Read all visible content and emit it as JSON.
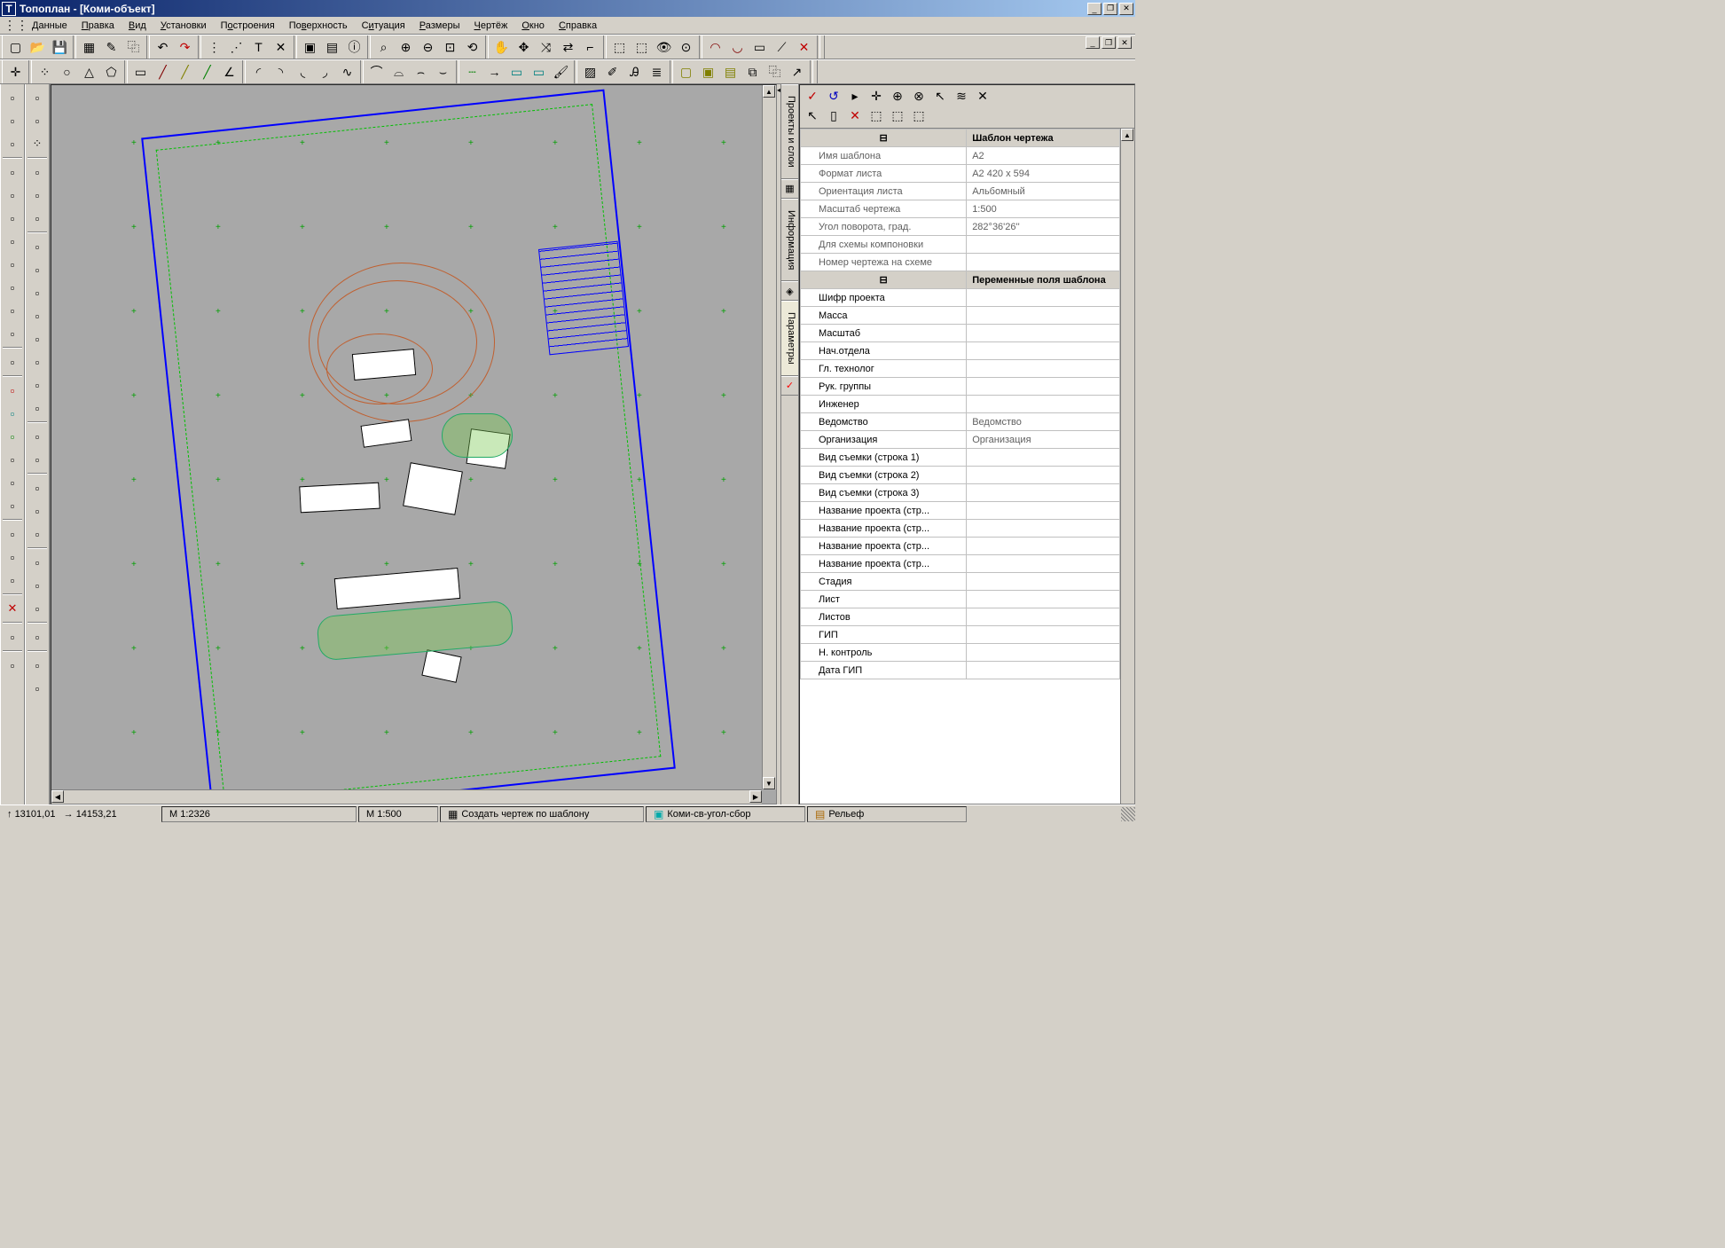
{
  "app": {
    "title": "Топоплан - [Коми-объект]",
    "icon_letter": "T"
  },
  "menu": {
    "items": [
      "Данные",
      "Правка",
      "Вид",
      "Установки",
      "Построения",
      "Поверхность",
      "Ситуация",
      "Размеры",
      "Чертёж",
      "Окно",
      "Справка"
    ],
    "underline_idx": [
      0,
      0,
      0,
      0,
      1,
      2,
      1,
      0,
      0,
      0,
      0
    ]
  },
  "toolbar_icons_row1": [
    "new",
    "open",
    "save",
    "grid",
    "pencil",
    "copy",
    "undo",
    "redo",
    "dots1",
    "dots2",
    "T",
    "cross",
    "win1",
    "win2",
    "info",
    "zoom-sel",
    "zoom-in",
    "zoom-out",
    "zoom-fit",
    "zoom-prev",
    "hand",
    "pan-all",
    "pan-xy",
    "arrow-bi",
    "corner",
    "sel1",
    "sel2",
    "view",
    "eye",
    "arc-r",
    "arc-l",
    "rect-r",
    "cross2",
    "x-red"
  ],
  "toolbar_icons_row2": [
    "plus-pt",
    "pts",
    "circ",
    "tri",
    "pent",
    "rect",
    "line-r",
    "line-y",
    "line-g",
    "angle",
    "curve1",
    "curve2",
    "curve3",
    "curve4",
    "curve5",
    "edge1",
    "edge2",
    "edge3",
    "edge4",
    "dash-g",
    "arrow-r",
    "cyan-a",
    "cyan-b",
    "brush",
    "hatch",
    "pen",
    "text",
    "layer",
    "sq-y",
    "sq-yl",
    "sq-yt",
    "sq-db",
    "sq-cp",
    "sq-ar"
  ],
  "left_bar_a": [
    "proj-open",
    "proj-tree",
    "proj-angle",
    "---",
    "surf-a",
    "surf-b",
    "surf-c",
    "surf-d",
    "surf-e",
    "surf-f",
    "surf-g",
    "surf-h",
    "---",
    "comb",
    "---",
    "b-red",
    "b-cyan",
    "b-green",
    "b-yr",
    "b-yl",
    "b-gr",
    "---",
    "tool-a",
    "tool-b",
    "tool-c",
    "---",
    "x-red",
    "---",
    "ruler-a",
    "---",
    "ruler-b"
  ],
  "left_bar_b": [
    "tree",
    "pt",
    "pts",
    "---",
    "line",
    "curve",
    "box",
    "---",
    "edit-a",
    "edit-b",
    "edit-c",
    "edit-d",
    "edit-e",
    "edit-f",
    "edit-g",
    "edit-h",
    "---",
    "comb2",
    "x2",
    "---",
    "sq-cy",
    "sq-gr",
    "arrow-d",
    "---",
    "tool-x",
    "tool-y",
    "tool-z",
    "---",
    "ruler-x",
    "---",
    "ruler-y",
    "hatch-y"
  ],
  "side_panel": {
    "tabs": [
      "Проекты и слои",
      "Информация",
      "Параметры"
    ],
    "active_tab": 2,
    "toolbar1": [
      "check-r",
      "rotate-b",
      "play",
      "plus",
      "target1",
      "target2",
      "cursor",
      "graph",
      "x"
    ],
    "toolbar2": [
      "cursor2",
      "page",
      "x-red",
      "sel-a",
      "sel-b",
      "sel-c"
    ]
  },
  "properties": {
    "sections": [
      {
        "title": "Шаблон чертежа",
        "rows": [
          {
            "label": "Имя шаблона",
            "value": "A2",
            "editable": false
          },
          {
            "label": "Формат листа",
            "value": "A2 420 x 594",
            "editable": false
          },
          {
            "label": "Ориентация листа",
            "value": "Альбомный",
            "editable": false
          },
          {
            "label": "Масштаб чертежа",
            "value": "1:500",
            "editable": false
          },
          {
            "label": "Угол поворота, град.",
            "value": " 282°36'26''",
            "editable": false
          },
          {
            "label": "Для схемы компоновки",
            "value": "",
            "editable": false
          },
          {
            "label": "Номер чертежа на схеме",
            "value": "",
            "editable": false
          }
        ]
      },
      {
        "title": "Переменные поля шаблона",
        "rows": [
          {
            "label": "Шифр проекта",
            "value": "",
            "editable": true
          },
          {
            "label": "Масса",
            "value": "",
            "editable": true
          },
          {
            "label": "Масштаб",
            "value": "",
            "editable": true
          },
          {
            "label": "Нач.отдела",
            "value": "",
            "editable": true
          },
          {
            "label": "Гл. технолог",
            "value": "",
            "editable": true
          },
          {
            "label": "Рук. группы",
            "value": "",
            "editable": true
          },
          {
            "label": "Инженер",
            "value": "",
            "editable": true
          },
          {
            "label": "Ведомство",
            "value": "Ведомство",
            "editable": true
          },
          {
            "label": "Организация",
            "value": "Организация",
            "editable": true
          },
          {
            "label": "Вид съемки (строка 1)",
            "value": "",
            "editable": true
          },
          {
            "label": "Вид съемки (строка 2)",
            "value": "",
            "editable": true
          },
          {
            "label": "Вид съемки (строка 3)",
            "value": "",
            "editable": true
          },
          {
            "label": "Название проекта (стр...",
            "value": "",
            "editable": true
          },
          {
            "label": "Название проекта (стр...",
            "value": "",
            "editable": true
          },
          {
            "label": "Название проекта (стр...",
            "value": "",
            "editable": true
          },
          {
            "label": "Название проекта (стр...",
            "value": "",
            "editable": true
          },
          {
            "label": "Стадия",
            "value": "",
            "editable": true
          },
          {
            "label": "Лист",
            "value": "",
            "editable": true
          },
          {
            "label": "Листов",
            "value": "",
            "editable": true
          },
          {
            "label": "ГИП",
            "value": "",
            "editable": true
          },
          {
            "label": "Н. контроль",
            "value": "",
            "editable": true
          },
          {
            "label": "Дата ГИП",
            "value": "",
            "editable": true
          }
        ]
      }
    ]
  },
  "status": {
    "coord_x_sym": "↑",
    "coord_x": "13101,01",
    "coord_y_sym": "→",
    "coord_y": "14153,21",
    "scale1": "М 1:2326",
    "scale2": "М 1:500",
    "cell_template": "Создать чертеж по шаблону",
    "cell_project": "Коми-св-угол-сбор",
    "cell_relief": "Рельеф"
  },
  "colors": {
    "frame": "#0000ff",
    "grid_cross": "#00a000",
    "contour": "#c06030"
  }
}
